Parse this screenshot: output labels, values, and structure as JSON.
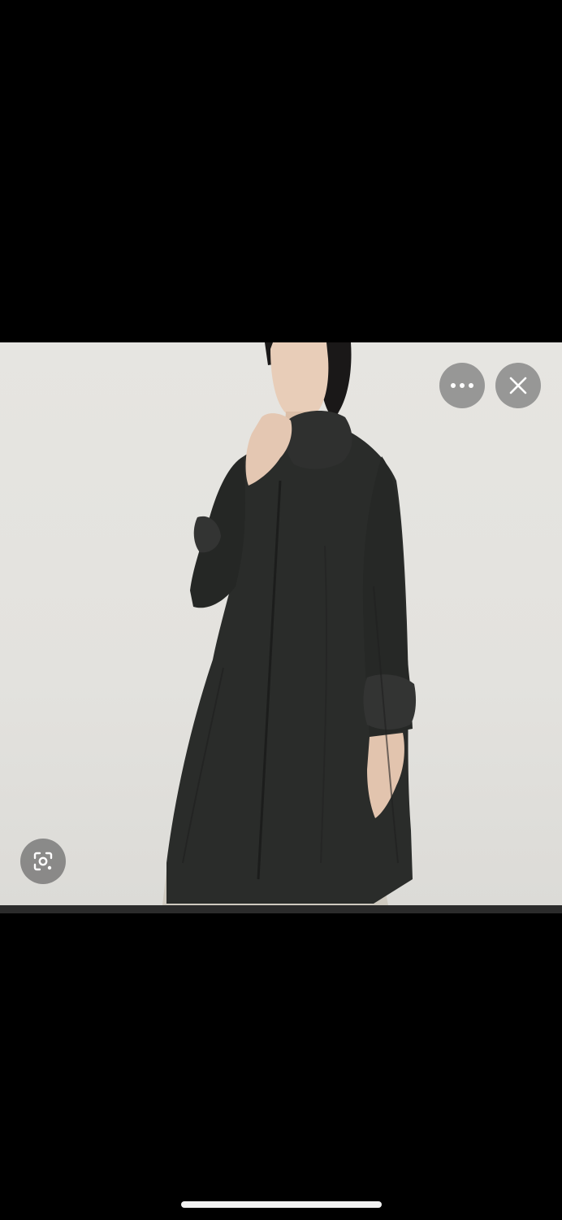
{
  "viewer": {
    "image_subject": "coat-photo",
    "background_color": "#000000",
    "photo_background": "#e4e3df",
    "coat_color": "#2a2c2a"
  },
  "controls": {
    "more_icon": "ellipsis-icon",
    "close_icon": "close-icon",
    "lens_icon": "lens-search-icon"
  }
}
